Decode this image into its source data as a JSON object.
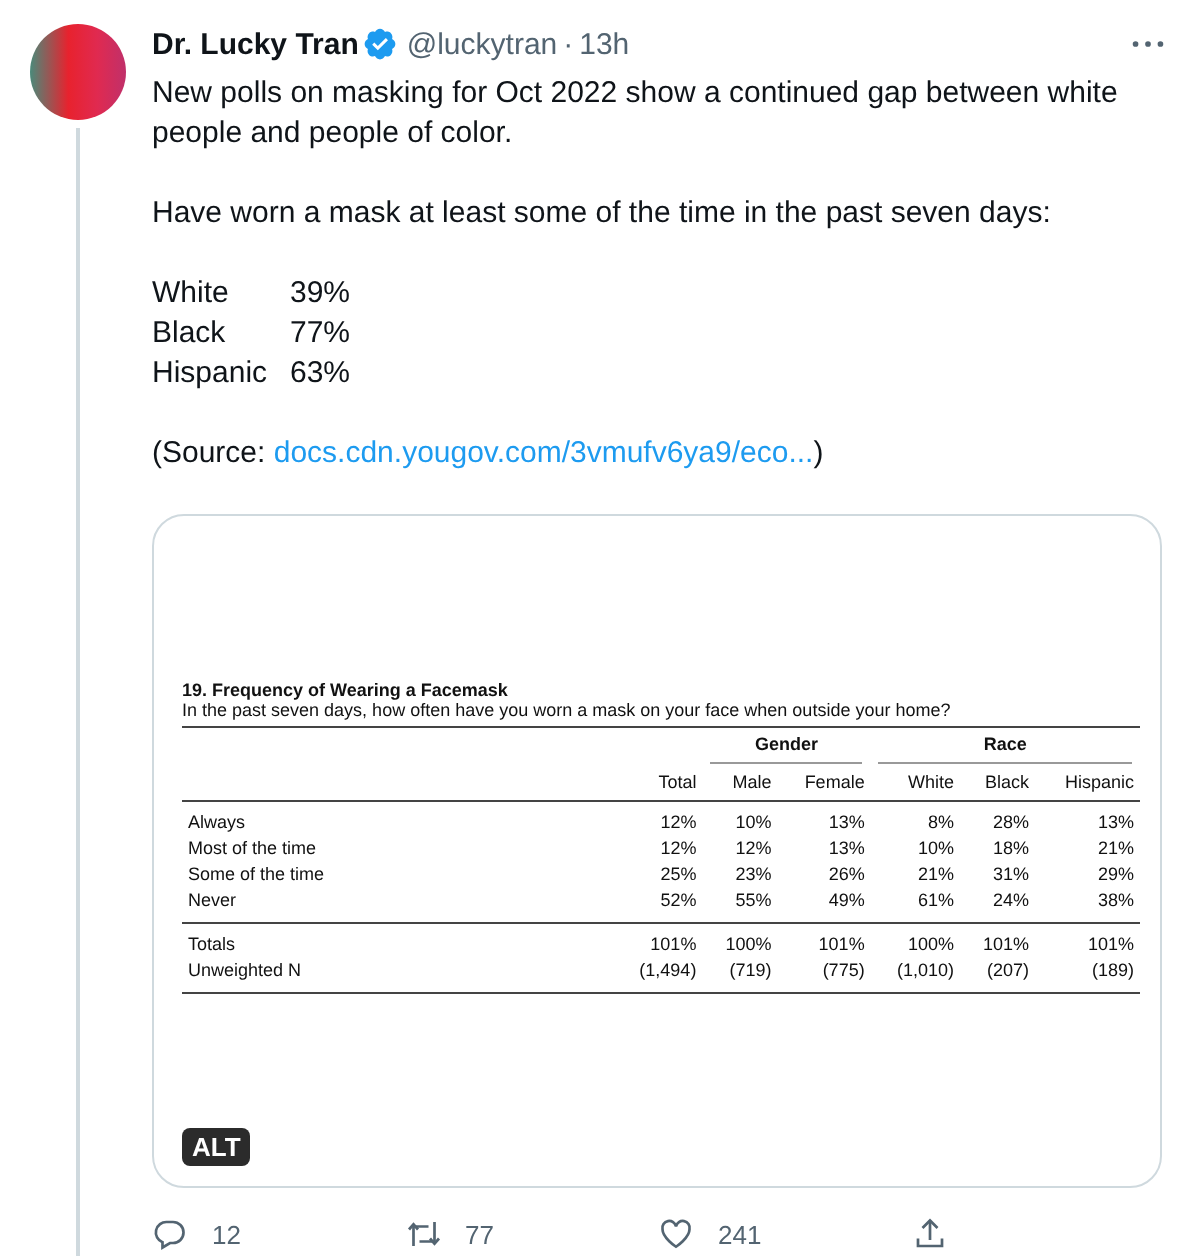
{
  "tweet": {
    "author": "Dr. Lucky Tran",
    "verified": true,
    "handle": "@luckytran",
    "separator": "·",
    "time": "13h",
    "paragraphs": [
      "New polls on masking for Oct 2022 show a continued gap between white people and people of color.",
      "Have worn a mask at least some of the time in the past seven days:"
    ],
    "stats": [
      {
        "group": "White",
        "value": "39%"
      },
      {
        "group": "Black",
        "value": "77%"
      },
      {
        "group": "Hispanic",
        "value": "63%"
      }
    ],
    "source": {
      "prefix": "(Source:",
      "link": "docs.cdn.yougov.com/3vmufv6ya9/eco...",
      "suffix": ")"
    }
  },
  "image": {
    "title": "19. Frequency of Wearing a Facemask",
    "question": "In the past seven days, how often have you worn a mask on your face when outside your home?",
    "ungrouped_columns": [
      "Total"
    ],
    "column_groups": [
      {
        "label": "Gender",
        "columns": [
          "Male",
          "Female"
        ]
      },
      {
        "label": "Race",
        "columns": [
          "White",
          "Black",
          "Hispanic"
        ]
      }
    ],
    "rows": [
      {
        "label": "Always",
        "values": [
          "12%",
          "10%",
          "13%",
          "8%",
          "28%",
          "13%"
        ]
      },
      {
        "label": "Most of the time",
        "values": [
          "12%",
          "12%",
          "13%",
          "10%",
          "18%",
          "21%"
        ]
      },
      {
        "label": "Some of the time",
        "values": [
          "25%",
          "23%",
          "26%",
          "21%",
          "31%",
          "29%"
        ]
      },
      {
        "label": "Never",
        "values": [
          "52%",
          "55%",
          "49%",
          "61%",
          "24%",
          "38%"
        ]
      }
    ],
    "total_rows": [
      {
        "label": "Totals",
        "values": [
          "101%",
          "100%",
          "101%",
          "100%",
          "101%",
          "101%"
        ]
      },
      {
        "label": "Unweighted N",
        "values": [
          "(1,494)",
          "(719)",
          "(775)",
          "(1,010)",
          "(207)",
          "(189)"
        ]
      }
    ],
    "alt_badge": "ALT"
  },
  "actions": [
    {
      "kind": "reply",
      "count": "12"
    },
    {
      "kind": "retweet",
      "count": "77"
    },
    {
      "kind": "like",
      "count": "241"
    },
    {
      "kind": "share"
    }
  ]
}
